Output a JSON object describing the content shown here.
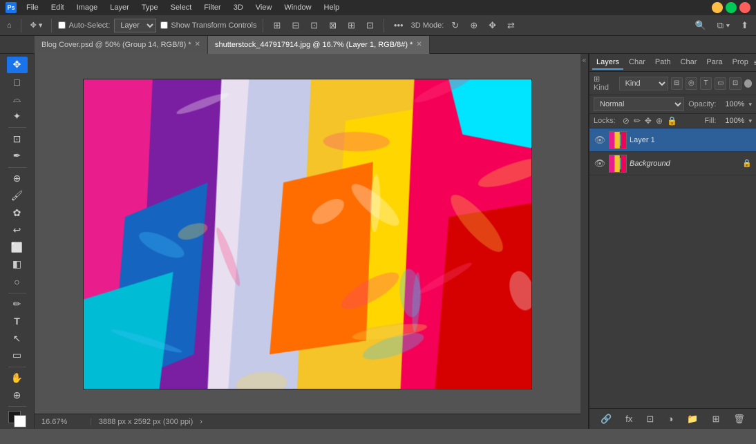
{
  "titleBar": {
    "appName": "Ps",
    "menuItems": [
      "File",
      "Edit",
      "Image",
      "Layer",
      "Type",
      "Select",
      "Filter",
      "3D",
      "View",
      "Window",
      "Help"
    ],
    "winControls": [
      "–",
      "□",
      "✕"
    ]
  },
  "optionsBar": {
    "moveToolIcon": "✥",
    "autoSelectLabel": "Auto-Select:",
    "autoSelectChecked": false,
    "layerDropdown": "Layer",
    "showTransformLabel": "Show Transform Controls",
    "showTransformChecked": false,
    "align_icons": [
      "⊞",
      "⊠",
      "⊡",
      "⊟",
      "⊞",
      "⊡"
    ],
    "modeLabel": "3D Mode:",
    "searchIcon": "🔍",
    "workspaceIcon": "⧉",
    "shareIcon": "⬆"
  },
  "tabs": [
    {
      "id": "tab1",
      "label": "Blog Cover.psd @ 50% (Group 14, RGB/8) *",
      "active": false,
      "closeable": true
    },
    {
      "id": "tab2",
      "label": "shutterstock_447917914.jpg @ 16.7% (Layer 1, RGB/8#) *",
      "active": true,
      "closeable": true
    }
  ],
  "tools": [
    {
      "id": "move",
      "icon": "✥",
      "active": true
    },
    {
      "id": "select-rect",
      "icon": "□"
    },
    {
      "id": "lasso",
      "icon": "⌓"
    },
    {
      "id": "magic-wand",
      "icon": "✧"
    },
    {
      "id": "crop",
      "icon": "⊡"
    },
    {
      "id": "eyedropper",
      "icon": "✒"
    },
    {
      "id": "heal",
      "icon": "⊕"
    },
    {
      "id": "brush",
      "icon": "🖌"
    },
    {
      "id": "clone",
      "icon": "✿"
    },
    {
      "id": "history-brush",
      "icon": "↩"
    },
    {
      "id": "eraser",
      "icon": "⬜"
    },
    {
      "id": "gradient",
      "icon": "◧"
    },
    {
      "id": "dodge",
      "icon": "○"
    },
    {
      "id": "pen",
      "icon": "✏"
    },
    {
      "id": "text",
      "icon": "T"
    },
    {
      "id": "path-select",
      "icon": "↖"
    },
    {
      "id": "shape",
      "icon": "▭"
    },
    {
      "id": "hand",
      "icon": "✋"
    },
    {
      "id": "zoom",
      "icon": "⊕"
    }
  ],
  "statusBar": {
    "zoom": "16.67%",
    "dimensions": "3888 px x 2592 px (300 ppi)",
    "arrow": "›"
  },
  "rightPanel": {
    "tabs": [
      {
        "label": "Layers",
        "active": true
      },
      {
        "label": "Char"
      },
      {
        "label": "Path"
      },
      {
        "label": "Char"
      },
      {
        "label": "Para"
      },
      {
        "label": "Prop"
      }
    ],
    "menuIcon": "≡",
    "filterKind": "Kind",
    "filterIcons": [
      "⊟",
      "◎",
      "T",
      "⊞",
      "≡"
    ],
    "filterCircle": "●",
    "blendMode": "Normal",
    "opacityLabel": "Opacity:",
    "opacityValue": "100%",
    "locksLabel": "Locks:",
    "lockIcons": [
      "✂",
      "✏",
      "✥",
      "⊕",
      "🔒"
    ],
    "fillLabel": "Fill:",
    "fillValue": "100%",
    "layers": [
      {
        "id": "layer1",
        "name": "Layer 1",
        "visible": true,
        "active": true,
        "italic": false,
        "locked": false
      },
      {
        "id": "background",
        "name": "Background",
        "visible": true,
        "active": false,
        "italic": true,
        "locked": true
      }
    ],
    "footerButtons": [
      "🔗",
      "fx",
      "⊞",
      "🗑",
      "☰",
      "🗁"
    ]
  },
  "canvas": {
    "paintColors": [
      "#e91e8c",
      "#f4c428",
      "#3db8e8",
      "#9c27b0",
      "#ff6b35",
      "#e8b4c8",
      "#ff4081",
      "#7c4dff"
    ]
  }
}
